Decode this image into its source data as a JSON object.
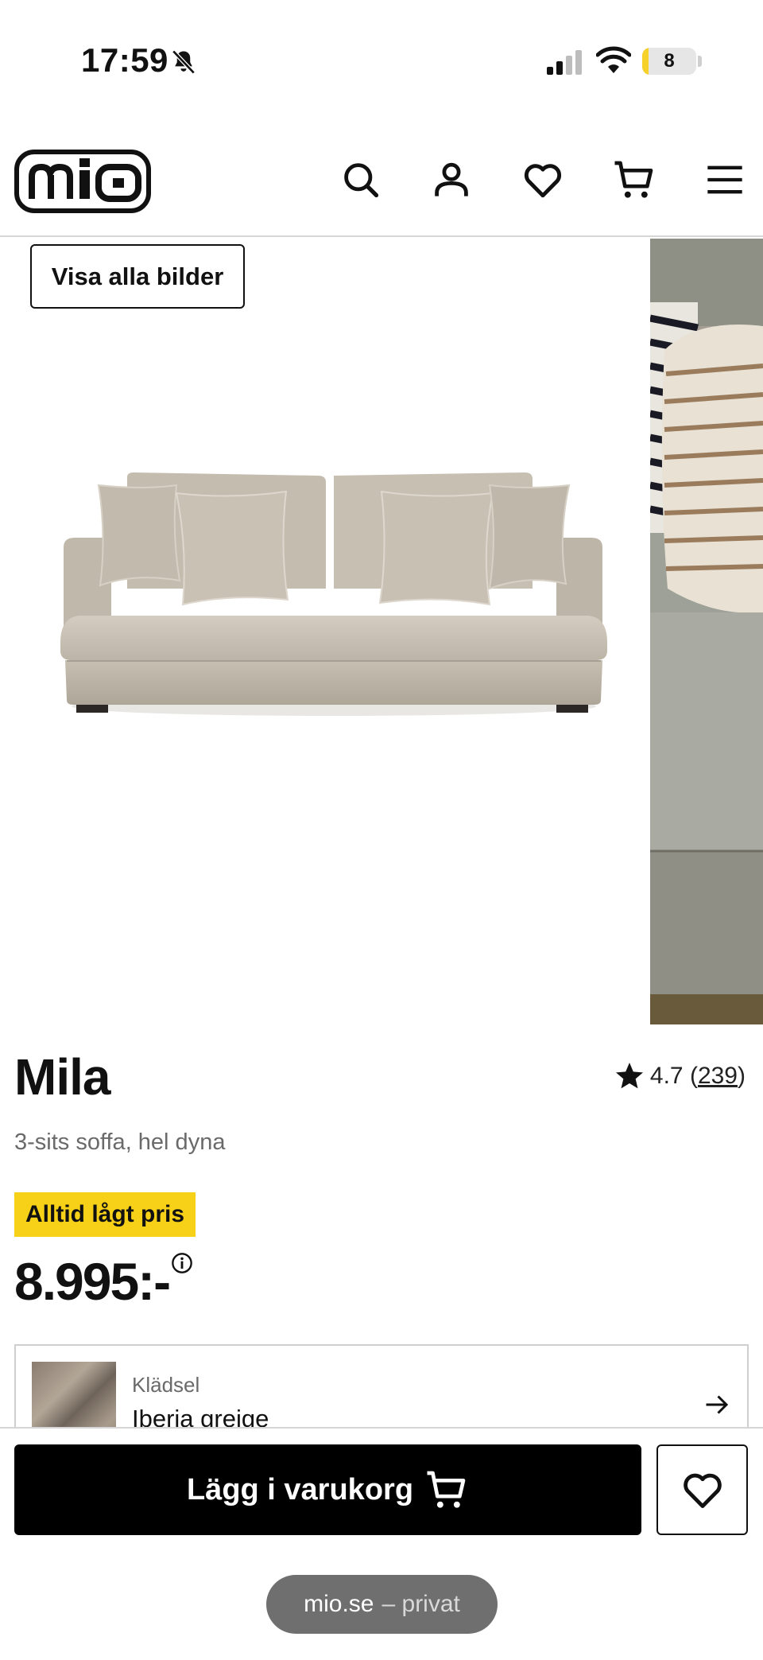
{
  "status_bar": {
    "time": "17:59",
    "battery_level": "8",
    "battery_fraction": 0.08
  },
  "header": {
    "logo_text": "mio",
    "icons": [
      "search-icon",
      "account-icon",
      "heart-icon",
      "cart-icon",
      "menu-icon"
    ]
  },
  "gallery": {
    "show_all_label": "Visa alla bilder"
  },
  "product": {
    "title": "Mila",
    "subtitle": "3-sits soffa, hel dyna",
    "rating": "4.7",
    "rating_count": "239",
    "badge": "Alltid lågt pris",
    "price": "8.995:-"
  },
  "upholstery": {
    "label": "Klädsel",
    "value": "Iberia greige"
  },
  "actions": {
    "add_to_cart_label": "Lägg i varukorg"
  },
  "browser": {
    "domain": "mio.se",
    "mode": "– privat"
  },
  "colors": {
    "badge_yellow": "#f7d117",
    "primary_button": "#000000",
    "sofa_fabric": "#c9c1b4"
  }
}
